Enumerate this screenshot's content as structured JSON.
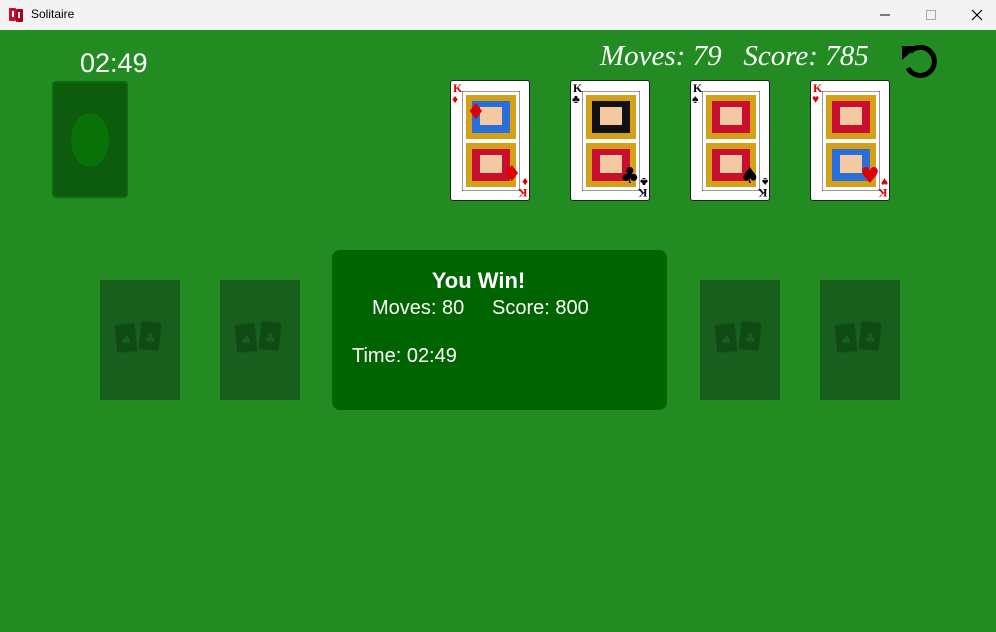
{
  "window": {
    "title": "Solitaire"
  },
  "hud": {
    "timer": "02:49",
    "moves_label": "Moves:",
    "moves": "79",
    "score_label": "Score:",
    "score": "785"
  },
  "foundations": [
    {
      "rank": "K",
      "suit": "♦",
      "color": "red"
    },
    {
      "rank": "K",
      "suit": "♣",
      "color": "black"
    },
    {
      "rank": "K",
      "suit": "♠",
      "color": "black"
    },
    {
      "rank": "K",
      "suit": "♥",
      "color": "red"
    }
  ],
  "dialog": {
    "title": "You Win!",
    "moves_text": "Moves: 80",
    "score_text": "Score: 800",
    "time_text": "Time: 02:49"
  },
  "colors": {
    "felt": "#228B22",
    "dialog": "#006400",
    "empty_slot": "#185e1c",
    "stock": "#0d5c0d"
  },
  "icons": {
    "undo": "undo-icon",
    "minimize": "minimize-icon",
    "maximize": "maximize-icon",
    "close": "close-icon"
  }
}
